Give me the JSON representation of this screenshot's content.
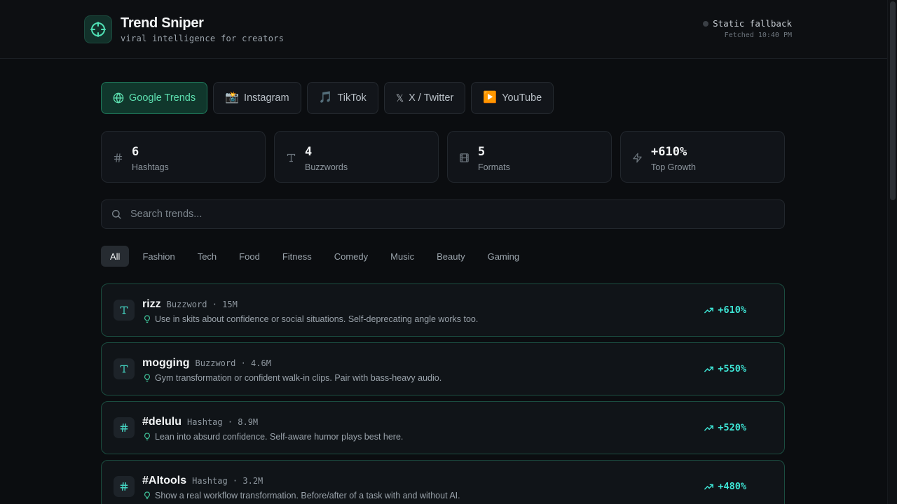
{
  "app": {
    "title": "Trend Sniper",
    "subtitle": "viral intelligence for creators",
    "status_text": "Static fallback",
    "fetched_text": "Fetched 10:40 PM"
  },
  "tabs": [
    {
      "label": "Google Trends",
      "icon": "globe-icon",
      "active": true
    },
    {
      "label": "Instagram",
      "icon": "📸"
    },
    {
      "label": "TikTok",
      "icon": "🎵"
    },
    {
      "label": "X / Twitter",
      "icon": "𝕏"
    },
    {
      "label": "YouTube",
      "icon": "▶️"
    }
  ],
  "stats": [
    {
      "value": "6",
      "label": "Hashtags",
      "icon": "hash-icon"
    },
    {
      "value": "4",
      "label": "Buzzwords",
      "icon": "type-icon"
    },
    {
      "value": "5",
      "label": "Formats",
      "icon": "film-icon"
    },
    {
      "value": "+610%",
      "label": "Top Growth",
      "icon": "zap-icon"
    }
  ],
  "search": {
    "placeholder": "Search trends..."
  },
  "categories": [
    "All",
    "Fashion",
    "Tech",
    "Food",
    "Fitness",
    "Comedy",
    "Music",
    "Beauty",
    "Gaming"
  ],
  "trends": [
    {
      "name": "rizz",
      "type": "Buzzword",
      "volume": "15M",
      "meta": "Buzzword · 15M",
      "tip": "Use in skits about confidence or social situations. Self-deprecating angle works too.",
      "growth": "+610%",
      "icon": "T"
    },
    {
      "name": "mogging",
      "type": "Buzzword",
      "volume": "4.6M",
      "meta": "Buzzword · 4.6M",
      "tip": "Gym transformation or confident walk-in clips. Pair with bass-heavy audio.",
      "growth": "+550%",
      "icon": "T"
    },
    {
      "name": "#delulu",
      "type": "Hashtag",
      "volume": "8.9M",
      "meta": "Hashtag · 8.9M",
      "tip": "Lean into absurd confidence. Self-aware humor plays best here.",
      "growth": "+520%",
      "icon": "#"
    },
    {
      "name": "#AItools",
      "type": "Hashtag",
      "volume": "3.2M",
      "meta": "Hashtag · 3.2M",
      "tip": "Show a real workflow transformation. Before/after of a task with and without AI.",
      "growth": "+480%",
      "icon": "#"
    }
  ],
  "colors": {
    "accent": "#3ee6d6",
    "active_tab_bg": "#10372c",
    "active_tab_text": "#5de0b0",
    "background": "#0b0d10"
  }
}
